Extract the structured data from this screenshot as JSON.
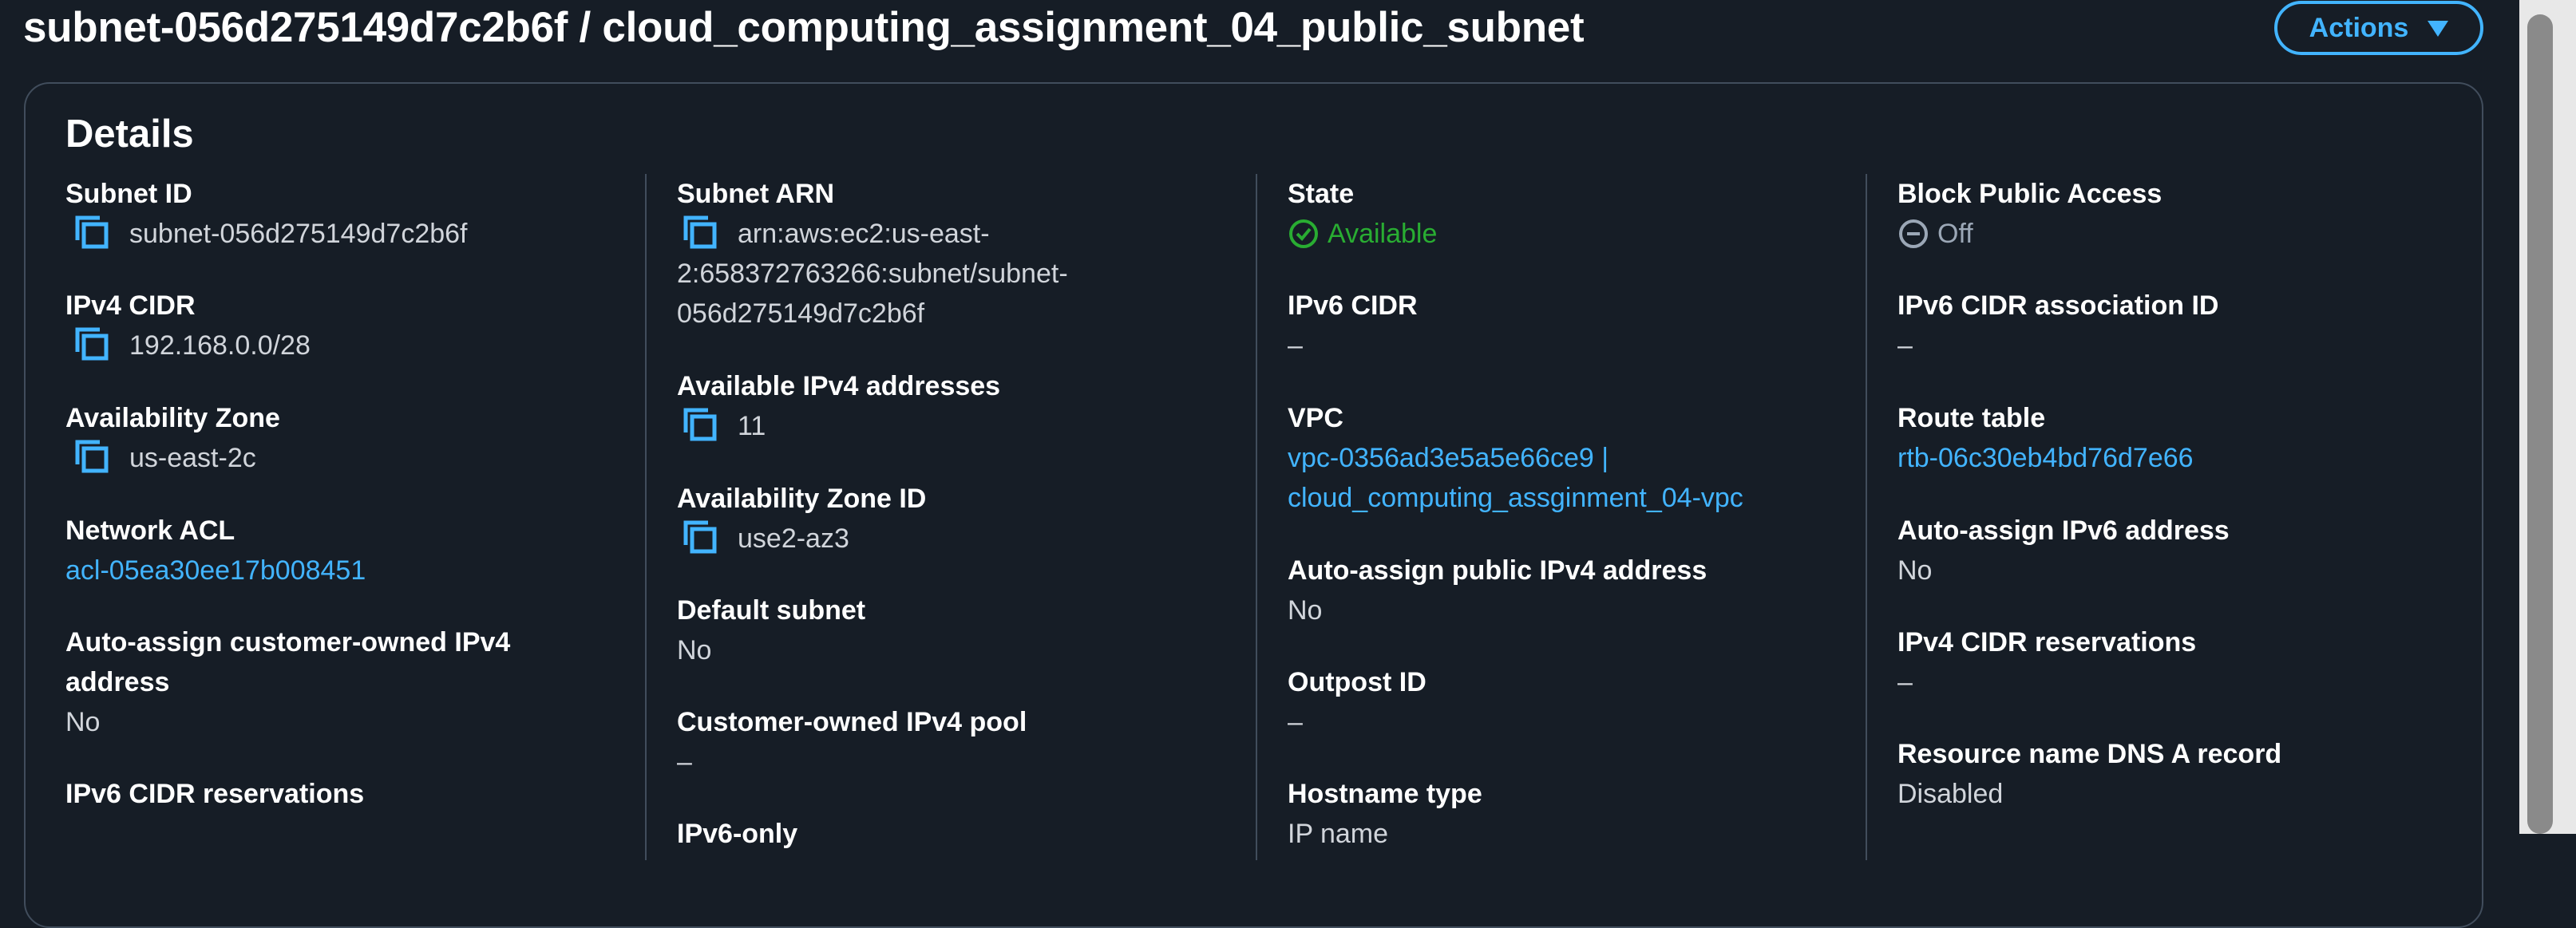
{
  "header": {
    "title": "subnet-056d275149d7c2b6f / cloud_computing_assignment_04_public_subnet",
    "actions_label": "Actions"
  },
  "details": {
    "title": "Details",
    "col1": {
      "subnet_id_label": "Subnet ID",
      "subnet_id_value": "subnet-056d275149d7c2b6f",
      "ipv4_cidr_label": "IPv4 CIDR",
      "ipv4_cidr_value": "192.168.0.0/28",
      "az_label": "Availability Zone",
      "az_value": "us-east-2c",
      "nacl_label": "Network ACL",
      "nacl_value": "acl-05ea30ee17b008451",
      "auto_assign_co_label": "Auto-assign customer-owned IPv4 address",
      "auto_assign_co_value": "No",
      "ipv6_cidr_res_label": "IPv6 CIDR reservations"
    },
    "col2": {
      "arn_label": "Subnet ARN",
      "arn_line1": "arn:aws:ec2:us-east-",
      "arn_line2": "2:658372763266:subnet/subnet-",
      "arn_line3": "056d275149d7c2b6f",
      "avail_ipv4_label": "Available IPv4 addresses",
      "avail_ipv4_value": "11",
      "az_id_label": "Availability Zone ID",
      "az_id_value": "use2-az3",
      "default_subnet_label": "Default subnet",
      "default_subnet_value": "No",
      "co_pool_label": "Customer-owned IPv4 pool",
      "co_pool_value": "–",
      "ipv6_only_label": "IPv6-only"
    },
    "col3": {
      "state_label": "State",
      "state_value": "Available",
      "ipv6_cidr_label": "IPv6 CIDR",
      "ipv6_cidr_value": "–",
      "vpc_label": "VPC",
      "vpc_line1": "vpc-0356ad3e5a5e66ce9 |",
      "vpc_line2": "cloud_computing_assginment_04-vpc",
      "auto_assign_public_label": "Auto-assign public IPv4 address",
      "auto_assign_public_value": "No",
      "outpost_label": "Outpost ID",
      "outpost_value": "–",
      "hostname_label": "Hostname type",
      "hostname_value": "IP name"
    },
    "col4": {
      "bpa_label": "Block Public Access",
      "bpa_value": "Off",
      "ipv6_assoc_label": "IPv6 CIDR association ID",
      "ipv6_assoc_value": "–",
      "route_table_label": "Route table",
      "route_table_value": "rtb-06c30eb4bd76d7e66",
      "auto_ipv6_label": "Auto-assign IPv6 address",
      "auto_ipv6_value": "No",
      "ipv4_res_label": "IPv4 CIDR reservations",
      "ipv4_res_value": "–",
      "dns_a_label": "Resource name DNS A record",
      "dns_a_value": "Disabled"
    }
  },
  "icons": {
    "copy": "copy-icon",
    "available": "check-circle-icon",
    "off": "minus-circle-icon",
    "actions": "caret-down-icon"
  },
  "colors": {
    "link": "#42b4ff",
    "success": "#29ad32",
    "background": "#161d26"
  }
}
